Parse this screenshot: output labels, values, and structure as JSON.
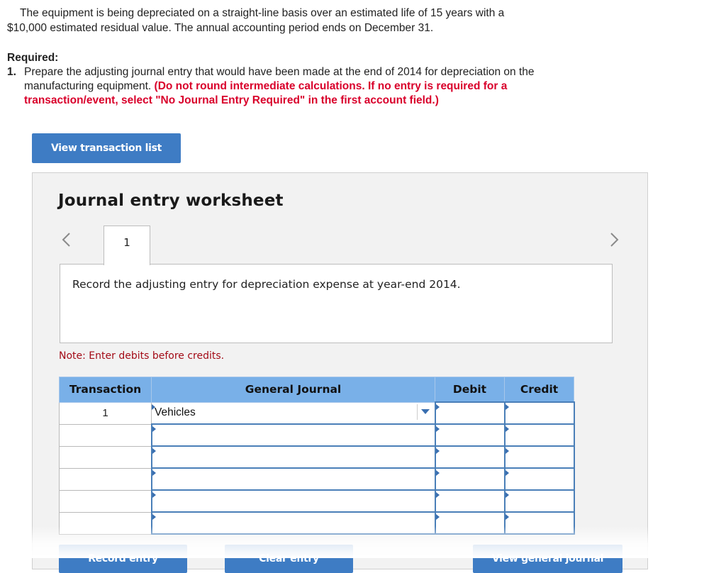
{
  "intro": {
    "line1": "The equipment is being depreciated on a straight-line basis over an estimated life of 15 years with a",
    "line2": "$10,000 estimated residual value. The annual accounting period ends on December 31."
  },
  "required": {
    "heading": "Required:",
    "item_number": "1.",
    "item_text": "Prepare the adjusting journal entry that would have been made at the end of 2014 for depreciation on the manufacturing equipment.",
    "item_instruction": "(Do not round intermediate calculations. If no entry is required for a transaction/event, select \"No Journal Entry Required\" in the first account field.)"
  },
  "buttons": {
    "view_transaction_list": "View transaction list",
    "record_entry": "Record entry",
    "clear_entry": "Clear entry",
    "view_general_journal": "View general journal"
  },
  "worksheet": {
    "title": "Journal entry worksheet",
    "tab_label": "1",
    "description": "Record the adjusting entry for depreciation expense at year-end 2014.",
    "note": "Note: Enter debits before credits."
  },
  "table": {
    "headers": {
      "transaction": "Transaction",
      "general_journal": "General Journal",
      "debit": "Debit",
      "credit": "Credit"
    },
    "rows": [
      {
        "transaction": "1",
        "account": "Vehicles",
        "debit": "",
        "credit": ""
      },
      {
        "transaction": "",
        "account": "",
        "debit": "",
        "credit": ""
      },
      {
        "transaction": "",
        "account": "",
        "debit": "",
        "credit": ""
      },
      {
        "transaction": "",
        "account": "",
        "debit": "",
        "credit": ""
      },
      {
        "transaction": "",
        "account": "",
        "debit": "",
        "credit": ""
      },
      {
        "transaction": "",
        "account": "",
        "debit": "",
        "credit": ""
      }
    ]
  },
  "colors": {
    "button_blue": "#3e7cc4",
    "header_blue": "#79b0e8",
    "instruction_red": "#d9002b",
    "note_red": "#a30a16"
  },
  "icons": {
    "prev": "chevron-left-icon",
    "next": "chevron-right-icon",
    "dropdown": "caret-down-icon"
  }
}
